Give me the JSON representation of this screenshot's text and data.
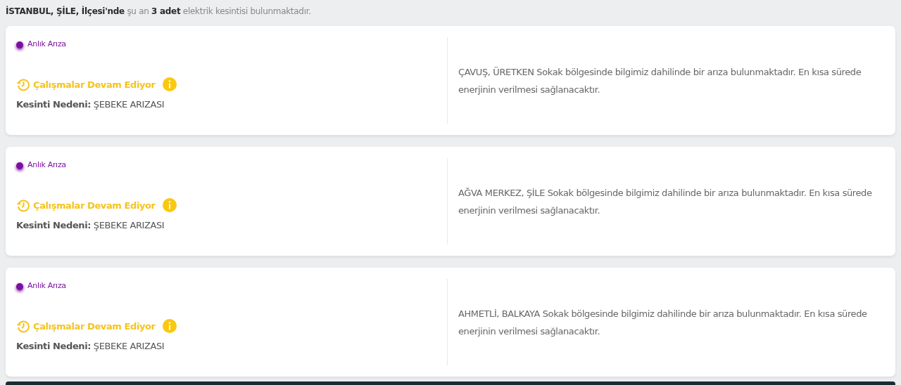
{
  "summary": "**İSTANBUL, ŞİLE, İlçesi'nde** şu an **3 adet** elektrik kesintisi bulunmaktadır.",
  "outages": [
    {
      "type": "Anlık Arıza",
      "color": "#7b0fa0",
      "status": "Çalışmalar Devam Ediyor",
      "reason_label": "Kesinti Nedeni:",
      "reason": "ŞEBEKE ARIZASI",
      "description": "ÇAVUŞ, ÜRETKEN Sokak bölgesinde bilgimiz dahilinde bir arıza bulunmaktadır. En kısa sürede enerjinin verilmesi sağlanacaktır."
    },
    {
      "type": "Anlık Arıza",
      "color": "#7b0fa0",
      "status": "Çalışmalar Devam Ediyor",
      "reason_label": "Kesinti Nedeni:",
      "reason": "ŞEBEKE ARIZASI",
      "description": "AĞVA MERKEZ, ŞİLE Sokak bölgesinde bilgimiz dahilinde bir arıza bulunmaktadır. En kısa sürede enerjinin verilmesi sağlanacaktır."
    },
    {
      "type": "Anlık Arıza",
      "color": "#7b0fa0",
      "status": "Çalışmalar Devam Ediyor",
      "reason_label": "Kesinti Nedeni:",
      "reason": "ŞEBEKE ARIZASI",
      "description": "AHMETLİ, BALKAYA Sokak bölgesinde bilgimiz dahilinde bir arıza bulunmaktadır. En kısa sürede enerjinin verilmesi sağlanacaktır."
    }
  ]
}
